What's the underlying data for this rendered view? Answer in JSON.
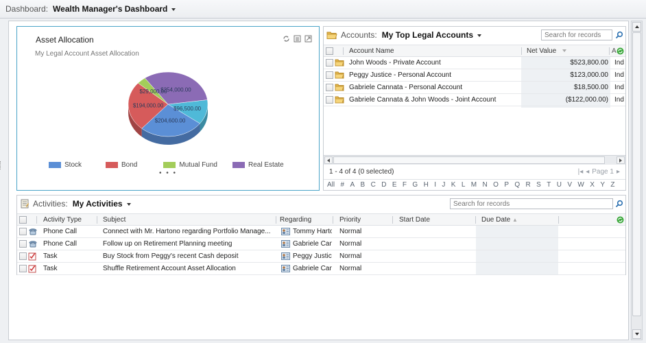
{
  "topbar": {
    "label": "Dashboard:",
    "title": "Wealth Manager's Dashboard"
  },
  "chart_panel": {
    "title": "Asset Allocation",
    "subtitle": "My Legal Account Asset Allocation",
    "tools": [
      "refresh-icon",
      "view-records-icon",
      "expand-icon"
    ],
    "more": "• • •"
  },
  "chart_data": {
    "type": "pie",
    "title": "Asset Allocation",
    "subtitle": "My Legal Account Asset Allocation",
    "legend_position": "bottom",
    "slices": [
      {
        "name": "Stock",
        "value": 204600,
        "label": "$204,600.00",
        "color": "#5b8fd6"
      },
      {
        "name": "Bond",
        "value": 194000,
        "label": "$194,000.00",
        "color": "#d65b5b"
      },
      {
        "name": "Mutual Fund",
        "value": 29000,
        "label": "$29,000.00",
        "color": "#a3cd5a"
      },
      {
        "name": "Real Estate",
        "value": 254000,
        "label": "$254,000.00",
        "color": "#8b6bb5"
      },
      {
        "name": "",
        "value": 96500,
        "label": "$96,500.00",
        "color": "#4fb9d8"
      }
    ],
    "legend": [
      {
        "name": "Stock",
        "color": "#5b8fd6"
      },
      {
        "name": "Bond",
        "color": "#d65b5b"
      },
      {
        "name": "Mutual Fund",
        "color": "#a3cd5a"
      },
      {
        "name": "Real Estate",
        "color": "#8b6bb5"
      }
    ]
  },
  "accounts": {
    "label": "Accounts:",
    "view": "My Top Legal Accounts",
    "search_placeholder": "Search for records",
    "columns": [
      "Account Name",
      "Net Value",
      "A"
    ],
    "rows": [
      {
        "name": "John Woods - Private Account",
        "net_value": "$523,800.00",
        "extra": "Ind"
      },
      {
        "name": "Peggy Justice - Personal Account",
        "net_value": "$123,000.00",
        "extra": "Ind"
      },
      {
        "name": "Gabriele Cannata - Personal Account",
        "net_value": "$18,500.00",
        "extra": "Ind"
      },
      {
        "name": "Gabriele Cannata & John Woods - Joint Account",
        "net_value": "($122,000.00)",
        "extra": "Ind"
      }
    ],
    "status": "1 - 4 of 4 (0 selected)",
    "page": "Page 1",
    "alpha": [
      "All",
      "#",
      "A",
      "B",
      "C",
      "D",
      "E",
      "F",
      "G",
      "H",
      "I",
      "J",
      "K",
      "L",
      "M",
      "N",
      "O",
      "P",
      "Q",
      "R",
      "S",
      "T",
      "U",
      "V",
      "W",
      "X",
      "Y",
      "Z"
    ]
  },
  "activities": {
    "label": "Activities:",
    "view": "My Activities",
    "search_placeholder": "Search for records",
    "columns": [
      "Activity Type",
      "Subject",
      "Regarding",
      "Priority",
      "Start Date",
      "Due Date"
    ],
    "rows": [
      {
        "type": "Phone Call",
        "icon": "phone-icon",
        "subject": "Connect with Mr. Hartono regarding Portfolio Manage...",
        "regarding": "Tommy Hartono",
        "priority": "Normal",
        "start": "",
        "due": ""
      },
      {
        "type": "Phone Call",
        "icon": "phone-icon",
        "subject": "Follow up on Retirement Planning meeting",
        "regarding": "Gabriele Cannata",
        "priority": "Normal",
        "start": "",
        "due": ""
      },
      {
        "type": "Task",
        "icon": "task-icon",
        "subject": "Buy Stock from Peggy's recent Cash deposit",
        "regarding": "Peggy Justice",
        "priority": "Normal",
        "start": "",
        "due": ""
      },
      {
        "type": "Task",
        "icon": "task-icon",
        "subject": "Shuffle Retirement Account Asset Allocation",
        "regarding": "Gabriele Cannata",
        "priority": "Normal",
        "start": "",
        "due": ""
      }
    ]
  }
}
